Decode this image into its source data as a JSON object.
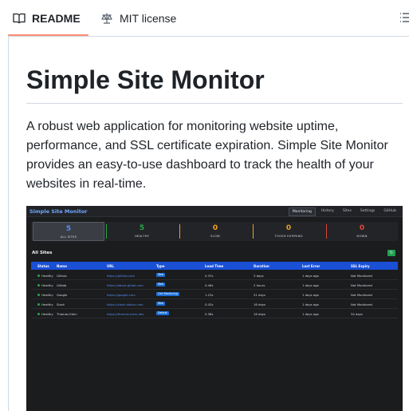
{
  "tabs": {
    "readme_label": "README",
    "license_label": "MIT license"
  },
  "readme": {
    "title": "Simple Site Monitor",
    "description": "A robust web application for monitoring website uptime, performance, and SSL certificate expiration. Simple Site Monitor provides an easy-to-use dashboard to track the health of your websites in real-time."
  },
  "dashboard": {
    "brand": "Simple Site Monitor",
    "nav": [
      "Monitoring",
      "History",
      "Sites",
      "Settings",
      "GitHub"
    ],
    "stats": [
      {
        "value": "5",
        "label": "ALL SITES",
        "color": "#4f8ff7"
      },
      {
        "value": "5",
        "label": "HEALTHY",
        "color": "#28a745"
      },
      {
        "value": "0",
        "label": "SLOW",
        "color": "#f0a020"
      },
      {
        "value": "0",
        "label": "TOOSH EXPIRING",
        "color": "#f0a020"
      },
      {
        "value": "0",
        "label": "DOWN",
        "color": "#e0463b"
      }
    ],
    "section_title": "All Sites",
    "refresh_icon": "refresh-icon",
    "columns": [
      "Status",
      "Name",
      "URL",
      "Type",
      "Load Time",
      "Duration",
      "Last Error",
      "SSL Expiry"
    ],
    "rows": [
      {
        "status": "Healthy",
        "name": "Github",
        "url": "https://github.com",
        "type": "Web",
        "load": "0.37s",
        "duration": "3 days",
        "last_error": "1 days ago",
        "ssl": "Not Monitored"
      },
      {
        "status": "Healthy",
        "name": "Giitlab",
        "url": "https://about.gitlab.com",
        "type": "Web",
        "load": "0.46s",
        "duration": "2 hours",
        "last_error": "1 days ago",
        "ssl": "Not Monitored"
      },
      {
        "status": "Healthy",
        "name": "Google",
        "url": "https://google.com",
        "type": "Cert Monitoring",
        "load": "1.23s",
        "duration": "21 days",
        "last_error": "1 days ago",
        "ssl": "Not Monitored"
      },
      {
        "status": "Healthy",
        "name": "Slack",
        "url": "https://slack-status.com",
        "type": "Web",
        "load": "0.42s",
        "duration": "16 days",
        "last_error": "1 days ago",
        "ssl": "Not Monitored"
      },
      {
        "status": "Healthy",
        "name": "Thomas Klein",
        "url": "https://thomas-klein.dev",
        "type": "Default",
        "load": "0.38s",
        "duration": "16 days",
        "last_error": "1 days ago",
        "ssl": "34 days"
      }
    ]
  },
  "colors": {
    "tab_underline": "#fd8c73",
    "table_header": "#1a4fd6",
    "healthy": "#28a745"
  }
}
